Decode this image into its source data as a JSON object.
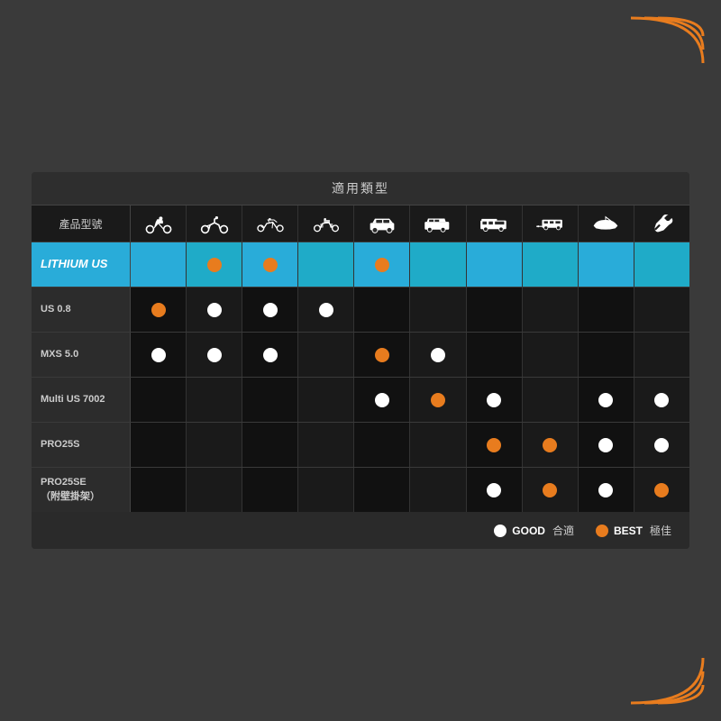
{
  "page": {
    "background_color": "#3a3a3a",
    "corner_color": "#e87c1e"
  },
  "table": {
    "section_title": "適用類型",
    "col_label": "產品型號",
    "columns": [
      {
        "id": "scooter",
        "icon": "scooter"
      },
      {
        "id": "atv",
        "icon": "atv"
      },
      {
        "id": "motorcycle",
        "icon": "motorcycle"
      },
      {
        "id": "touring",
        "icon": "touring"
      },
      {
        "id": "suv",
        "icon": "suv"
      },
      {
        "id": "truck",
        "icon": "truck"
      },
      {
        "id": "rv",
        "icon": "rv"
      },
      {
        "id": "trailer",
        "icon": "trailer"
      },
      {
        "id": "boat",
        "icon": "boat"
      },
      {
        "id": "wrench",
        "icon": "wrench"
      }
    ],
    "rows": [
      {
        "id": "lithium-us",
        "label": "LITHIUM US",
        "highlight": true,
        "dots": [
          "none",
          "orange",
          "orange",
          "none",
          "orange",
          "none",
          "none",
          "none",
          "none",
          "none"
        ]
      },
      {
        "id": "us-0.8",
        "label": "US 0.8",
        "highlight": false,
        "dots": [
          "orange",
          "white",
          "white",
          "white",
          "none",
          "none",
          "none",
          "none",
          "none",
          "none"
        ]
      },
      {
        "id": "mxs-5.0",
        "label": "MXS 5.0",
        "highlight": false,
        "dots": [
          "white",
          "white",
          "white",
          "none",
          "orange",
          "white",
          "none",
          "none",
          "none",
          "none"
        ]
      },
      {
        "id": "multi-us-7002",
        "label": "Multi US 7002",
        "highlight": false,
        "dots": [
          "none",
          "none",
          "none",
          "none",
          "white",
          "orange",
          "white",
          "none",
          "white",
          "white",
          "white"
        ]
      },
      {
        "id": "pro25s",
        "label": "PRO25S",
        "highlight": false,
        "dots": [
          "none",
          "none",
          "none",
          "none",
          "none",
          "none",
          "orange",
          "orange",
          "white",
          "white"
        ]
      },
      {
        "id": "pro25se",
        "label": "PRO25SE\n（附壁掛架）",
        "highlight": false,
        "dots": [
          "none",
          "none",
          "none",
          "none",
          "none",
          "none",
          "white",
          "orange",
          "white",
          "orange"
        ]
      }
    ],
    "legend": {
      "good_label": "GOOD",
      "good_text": "合適",
      "best_label": "BEST",
      "best_text": "極佳"
    }
  }
}
